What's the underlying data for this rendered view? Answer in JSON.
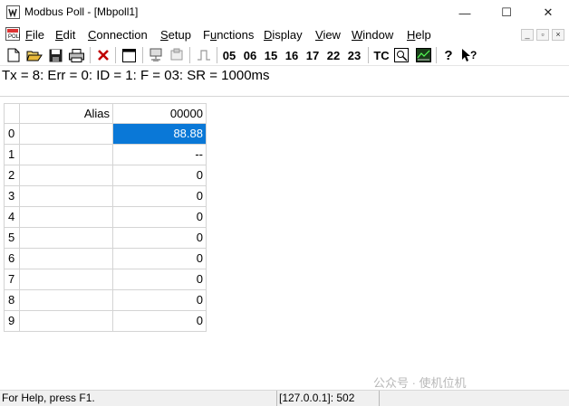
{
  "window": {
    "title": "Modbus Poll - [Mbpoll1]",
    "min_glyph": "—",
    "max_glyph": "☐",
    "close_glyph": "✕"
  },
  "menu": {
    "items": [
      {
        "label": "File",
        "key": "F",
        "rest": "ile"
      },
      {
        "label": "Edit",
        "key": "E",
        "rest": "dit"
      },
      {
        "label": "Connection",
        "key": "C",
        "rest": "onnection"
      },
      {
        "label": "Setup",
        "key": "S",
        "rest": "etup"
      },
      {
        "label": "Functions",
        "key": "u",
        "pre": "F",
        "rest": "nctions"
      },
      {
        "label": "Display",
        "key": "D",
        "rest": "isplay"
      },
      {
        "label": "View",
        "key": "V",
        "rest": "iew"
      },
      {
        "label": "Window",
        "key": "W",
        "rest": "indow"
      },
      {
        "label": "Help",
        "key": "H",
        "rest": "elp"
      }
    ],
    "mdi_min": "_",
    "mdi_restore": "▫",
    "mdi_close": "×"
  },
  "toolbar": {
    "functions": [
      "05",
      "06",
      "15",
      "16",
      "17",
      "22",
      "23"
    ],
    "tc_label": "TC",
    "icons": [
      "new-icon",
      "open-icon",
      "save-icon",
      "print-icon",
      "delete-icon",
      "window-icon",
      "connect-icon",
      "disconnect-icon",
      "pulse-icon",
      "monitor-icon",
      "chart-icon",
      "help-icon",
      "context-help-icon"
    ]
  },
  "status_line": "Tx = 8: Err = 0: ID = 1: F = 03: SR = 1000ms",
  "grid": {
    "col_alias": "Alias",
    "col_value": "00000",
    "rows": [
      {
        "index": "0",
        "alias": "",
        "value": "88.88",
        "selected": true
      },
      {
        "index": "1",
        "alias": "",
        "value": "--"
      },
      {
        "index": "2",
        "alias": "",
        "value": "0"
      },
      {
        "index": "3",
        "alias": "",
        "value": "0"
      },
      {
        "index": "4",
        "alias": "",
        "value": "0"
      },
      {
        "index": "5",
        "alias": "",
        "value": "0"
      },
      {
        "index": "6",
        "alias": "",
        "value": "0"
      },
      {
        "index": "7",
        "alias": "",
        "value": "0"
      },
      {
        "index": "8",
        "alias": "",
        "value": "0"
      },
      {
        "index": "9",
        "alias": "",
        "value": "0"
      }
    ]
  },
  "statusbar": {
    "help": "For Help, press F1.",
    "connection": "[127.0.0.1]: 502"
  },
  "watermark": "公众号 · 使机位机",
  "colors": {
    "selection": "#0a78d7",
    "grid_line": "#d4d4d4"
  }
}
